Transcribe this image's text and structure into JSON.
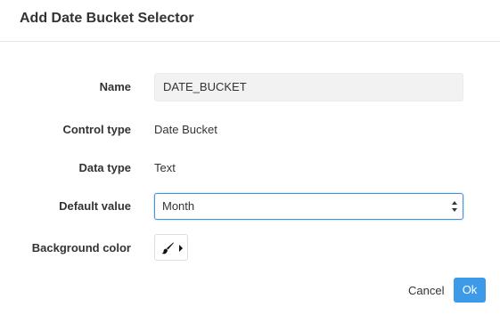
{
  "dialog": {
    "title": "Add Date Bucket Selector"
  },
  "form": {
    "name": {
      "label": "Name",
      "value": "DATE_BUCKET"
    },
    "control_type": {
      "label": "Control type",
      "value": "Date Bucket"
    },
    "data_type": {
      "label": "Data type",
      "value": "Text"
    },
    "default_value": {
      "label": "Default value",
      "selected": "Month"
    },
    "background_color": {
      "label": "Background color",
      "icon": "brush-icon"
    }
  },
  "footer": {
    "cancel_label": "Cancel",
    "ok_label": "Ok"
  },
  "colors": {
    "accent": "#3d9ae8",
    "focus_border": "#4a90d9"
  }
}
